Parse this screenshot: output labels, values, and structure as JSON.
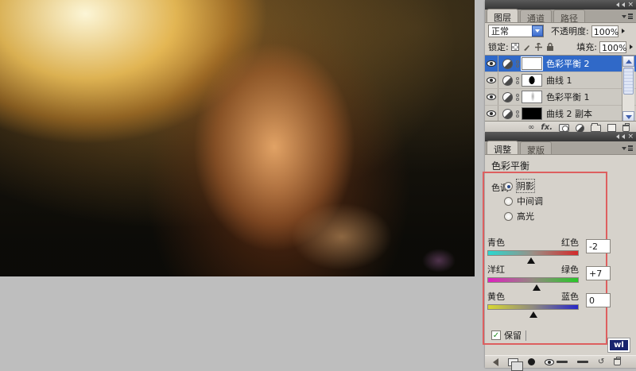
{
  "colors": {
    "workspace_bg": "#bebebe",
    "panel_bg": "#d6d2cb",
    "selected_layer": "#3069c8",
    "annotation_red": "#dd5f5f",
    "watermark_navy": "#18246e"
  },
  "layers_panel": {
    "tabs": [
      {
        "label": "图层",
        "active": true
      },
      {
        "label": "通道",
        "active": false
      },
      {
        "label": "路径",
        "active": false
      }
    ],
    "blend_mode": "正常",
    "opacity_label": "不透明度:",
    "opacity_value": "100%",
    "lock_label": "锁定:",
    "fill_label": "填充:",
    "fill_value": "100%",
    "layers": [
      {
        "name": "色彩平衡 2",
        "selected": true,
        "thumb": "white"
      },
      {
        "name": "曲线 1",
        "selected": false,
        "thumb": "white-blob"
      },
      {
        "name": "色彩平衡 1",
        "selected": false,
        "thumb": "white-smudge"
      },
      {
        "name": "曲线 2 副本",
        "selected": false,
        "thumb": "black"
      }
    ],
    "footer_icons": [
      "link-icon",
      "fx-icon",
      "add-mask-icon",
      "adjustment-icon",
      "group-icon",
      "new-layer-icon",
      "trash-icon"
    ]
  },
  "adjustments_panel": {
    "tabs": [
      {
        "label": "调整",
        "active": true
      },
      {
        "label": "蒙版",
        "active": false
      }
    ],
    "title": "色彩平衡",
    "tone_label": "色调:",
    "tone_options": [
      {
        "label": "阴影",
        "selected": true
      },
      {
        "label": "中间调",
        "selected": false
      },
      {
        "label": "高光",
        "selected": false
      }
    ],
    "sliders": [
      {
        "left_label": "青色",
        "right_label": "红色",
        "value": "-2",
        "position_pct": 48
      },
      {
        "left_label": "洋红",
        "right_label": "绿色",
        "value": "+7",
        "position_pct": 54
      },
      {
        "left_label": "黄色",
        "right_label": "蓝色",
        "value": "0",
        "position_pct": 50
      }
    ],
    "preserve_checkbox": {
      "checked": true,
      "check_glyph": "✓",
      "label": "保留"
    }
  },
  "watermark": {
    "text": "wl"
  }
}
